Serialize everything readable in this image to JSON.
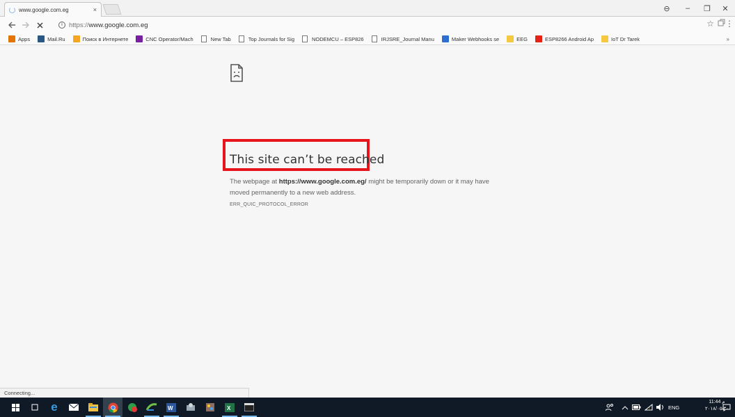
{
  "browser": {
    "tab_title": "www.google.com.eg",
    "tab_close": "×",
    "window_controls": {
      "profile": "⊖",
      "minimize": "–",
      "restore": "❐",
      "close": "✕"
    },
    "url_scheme": "https://",
    "url_host": "www.google.com.eg",
    "status_text": "Connecting..."
  },
  "bookmarks": [
    {
      "label": "Apps",
      "icon": "apps-grid-icon",
      "color": "#e37400"
    },
    {
      "label": "Mail.Ru",
      "icon": "mailru-icon",
      "color": "#2a5885"
    },
    {
      "label": "Поиск в Интернете",
      "icon": "search-globe-icon",
      "color": "#f5a623"
    },
    {
      "label": "CNC Operator/Mach",
      "icon": "m-logo-icon",
      "color": "#7b1fa2"
    },
    {
      "label": "New Tab",
      "icon": "page-icon",
      "color": "#ffffff"
    },
    {
      "label": "Top Journals for Sig",
      "icon": "page-icon",
      "color": "#ffffff"
    },
    {
      "label": "NODEMCU – ESP826",
      "icon": "page-icon",
      "color": "#ffffff"
    },
    {
      "label": "IRJSRE_Journal Manu",
      "icon": "page-icon",
      "color": "#ffffff"
    },
    {
      "label": "Maker Webhooks se",
      "icon": "maker-icon",
      "color": "#2c6fd1"
    },
    {
      "label": "EEG",
      "icon": "folder-icon",
      "color": "#f5c842"
    },
    {
      "label": "ESP8266 Android Ap",
      "icon": "youtube-icon",
      "color": "#e62117"
    },
    {
      "label": "IoT Dr Tarek",
      "icon": "folder-icon",
      "color": "#f5c842"
    }
  ],
  "bookmarks_more": "»",
  "error": {
    "title": "This site can’t be reached",
    "body_prefix": "The webpage at ",
    "body_url": "https://www.google.com.eg/",
    "body_mid": " might be temporarily down or it may have",
    "body_line2": "moved permanently to a new web address.",
    "code": "ERR_QUIC_PROTOCOL_ERROR",
    "highlight_color": "#e8141c"
  },
  "taskbar": {
    "lang": "ENG",
    "time": "11:44 م",
    "date": "٢٠١٨/٠٥/٣٠"
  }
}
